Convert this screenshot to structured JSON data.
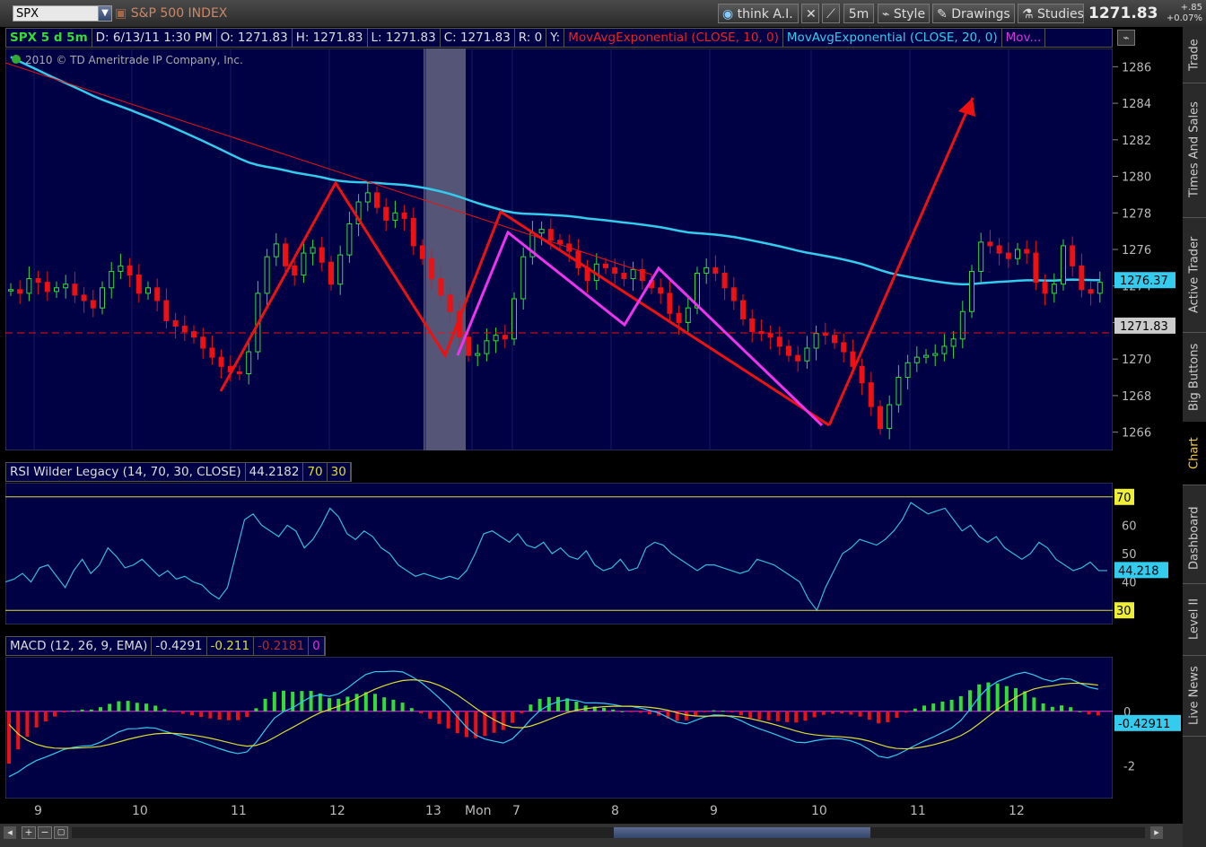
{
  "toolbar": {
    "symbol": "SPX",
    "description": "S&P 500 INDEX",
    "think_label": "think A.I.",
    "interval": "5m",
    "style_label": "Style",
    "drawings_label": "Drawings",
    "studies_label": "Studies",
    "last_price": "1271.83",
    "change_abs": "+.85",
    "change_pct": "+0.07%"
  },
  "header": {
    "chart_title": "SPX 5 d 5m",
    "date": "D: 6/13/11 1:30 PM",
    "open": "O: 1271.83",
    "high": "H: 1271.83",
    "low": "L: 1271.83",
    "close": "C: 1271.83",
    "range": "R: 0",
    "y": "Y:",
    "study1": "MovAvgExponential (CLOSE, 10, 0)",
    "study2": "MovAvgExponential (CLOSE, 20, 0)",
    "study3": "Mov...",
    "copyright": "2010 © TD Ameritrade IP Company, Inc."
  },
  "right_tabs": [
    "Trade",
    "Times And Sales",
    "Active Trader",
    "Big Buttons",
    "Chart",
    "Dashboard",
    "Level II",
    "Live News"
  ],
  "colors": {
    "panel_bg": "#000044",
    "up": "#33dd33",
    "down": "#ee1111",
    "ema_cyan": "#33ccee",
    "trend_red": "#ee1111",
    "trend_magenta": "#ee33ee",
    "rsi_line": "#33bbdd",
    "level_yellow": "#dddd33"
  },
  "chart_data": [
    {
      "type": "candlestick",
      "title": "SPX 5 d 5m",
      "ylim": [
        1265,
        1287
      ],
      "yticks": [
        1266,
        1268,
        1270,
        1272,
        1274,
        1276,
        1278,
        1280,
        1282,
        1284,
        1286
      ],
      "xticks": [
        "9",
        "10",
        "11",
        "12",
        "13",
        "Mon",
        "7",
        "8",
        "9",
        "10",
        "11",
        "12"
      ],
      "bars": 120,
      "close_path": [
        1273.8,
        1273.6,
        1274.4,
        1274.2,
        1273.7,
        1273.9,
        1274.1,
        1273.5,
        1273.2,
        1272.8,
        1273.9,
        1274.8,
        1275.1,
        1274.6,
        1273.6,
        1273.9,
        1273.2,
        1272.1,
        1271.8,
        1271.5,
        1271.2,
        1270.6,
        1270.1,
        1269.6,
        1269.3,
        1269.2,
        1270.4,
        1273.6,
        1275.6,
        1276.3,
        1275.1,
        1274.6,
        1275.8,
        1276.1,
        1275.3,
        1274.1,
        1275.7,
        1277.4,
        1278.6,
        1279.1,
        1278.3,
        1277.6,
        1278.0,
        1277.7,
        1276.2,
        1275.5,
        1274.4,
        1273.5,
        1272.6,
        1271.2,
        1270.2,
        1270.3,
        1271.0,
        1271.3,
        1271.1,
        1273.3,
        1275.6,
        1276.9,
        1277.1,
        1276.5,
        1276.3,
        1275.9,
        1275.0,
        1274.3,
        1275.2,
        1275.0,
        1274.7,
        1274.4,
        1274.9,
        1274.3,
        1273.9,
        1273.6,
        1272.5,
        1272.0,
        1272.8,
        1274.7,
        1275.0,
        1274.7,
        1273.9,
        1273.2,
        1272.2,
        1271.5,
        1271.4,
        1271.2,
        1270.7,
        1270.2,
        1269.9,
        1270.6,
        1271.4,
        1271.3,
        1270.9,
        1270.4,
        1269.6,
        1268.7,
        1267.4,
        1266.2,
        1267.5,
        1269.0,
        1269.8,
        1270.1,
        1270.2,
        1270.3,
        1270.7,
        1271.1,
        1272.6,
        1274.8,
        1276.4,
        1276.2,
        1275.8,
        1275.5,
        1276.0,
        1275.8,
        1274.2,
        1273.6,
        1274.1,
        1276.2,
        1275.1,
        1273.8,
        1273.6,
        1274.2
      ],
      "labels": {
        "price_tag": "1271.83",
        "ema_tag": "1276.37"
      }
    },
    {
      "type": "line",
      "title": "RSI Wilder Legacy (14, 70, 30, CLOSE)",
      "value_label": "44.2182",
      "overbought": "70",
      "oversold": "30",
      "ylim": [
        25,
        75
      ],
      "yticks": [
        40,
        50,
        60
      ],
      "tag": "44.218",
      "values": [
        40,
        41,
        43,
        40,
        45,
        46,
        42,
        38,
        44,
        48,
        43,
        46,
        52,
        49,
        45,
        46,
        48,
        45,
        42,
        44,
        41,
        42,
        40,
        39,
        36,
        34,
        38,
        50,
        62,
        64,
        60,
        58,
        56,
        60,
        58,
        52,
        55,
        60,
        66,
        63,
        57,
        55,
        58,
        56,
        52,
        50,
        46,
        44,
        42,
        43,
        42,
        41,
        42,
        41,
        44,
        50,
        57,
        58,
        56,
        54,
        57,
        53,
        52,
        54,
        50,
        52,
        49,
        48,
        51,
        46,
        44,
        45,
        48,
        44,
        45,
        52,
        54,
        53,
        50,
        48,
        46,
        44,
        46,
        46,
        45,
        44,
        43,
        44,
        48,
        47,
        46,
        44,
        42,
        40,
        34,
        30,
        38,
        44,
        50,
        52,
        55,
        54,
        53,
        55,
        58,
        62,
        68,
        66,
        64,
        65,
        66,
        62,
        58,
        60,
        56,
        54,
        56,
        52,
        50,
        48,
        50,
        54,
        52,
        48,
        46,
        44,
        45,
        47,
        44,
        44
      ],
      "note": "RSI panel"
    },
    {
      "type": "bar",
      "title": "MACD (12, 26, 9, EMA)",
      "value_label": "-0.4291",
      "avg_label": "-0.211",
      "diff_label": "-0.2181",
      "zero_label": "0",
      "ylim": [
        -3.2,
        2
      ],
      "yticks": [
        -2,
        0
      ],
      "tag": "-0.42911"
    }
  ]
}
